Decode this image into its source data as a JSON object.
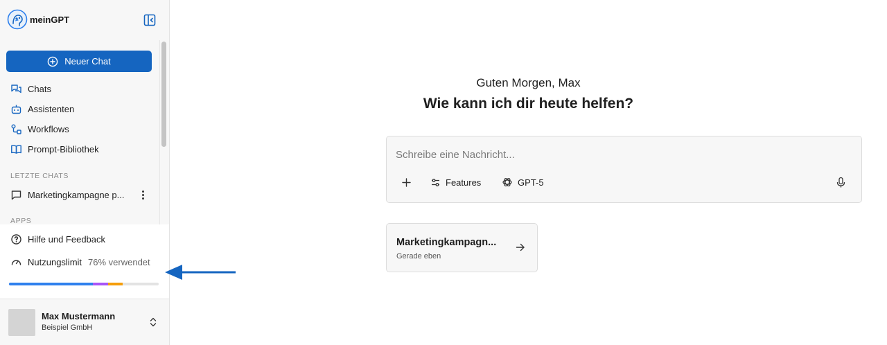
{
  "app": {
    "name": "meinGPT",
    "accent": "#1565c0"
  },
  "sidebar": {
    "new_chat_label": "Neuer Chat",
    "nav": [
      {
        "label": "Chats",
        "icon": "chats-icon"
      },
      {
        "label": "Assistenten",
        "icon": "robot-icon"
      },
      {
        "label": "Workflows",
        "icon": "workflow-icon"
      },
      {
        "label": "Prompt-Bibliothek",
        "icon": "book-icon"
      }
    ],
    "recent_label": "LETZTE CHATS",
    "recent_chats": [
      {
        "title": "Marketingkampagne p..."
      }
    ],
    "apps_label": "APPS",
    "help_label": "Hilfe und Feedback",
    "usage": {
      "label": "Nutzungslimit",
      "value_text": "76% verwendet",
      "fraction": 0.76,
      "segment_colors": [
        "#2f80ed",
        "#a855f7",
        "#f59e0b"
      ]
    },
    "user": {
      "name": "Max Mustermann",
      "company": "Beispiel GmbH"
    }
  },
  "main": {
    "greeting": "Guten Morgen, Max",
    "headline": "Wie kann ich dir heute helfen?",
    "composer": {
      "placeholder": "Schreibe eine Nachricht...",
      "features_label": "Features",
      "model_label": "GPT-5"
    },
    "recent_card": {
      "title": "Marketingkampagn...",
      "subtitle": "Gerade eben"
    }
  },
  "annotation": {
    "arrow_color": "#1565c0"
  }
}
